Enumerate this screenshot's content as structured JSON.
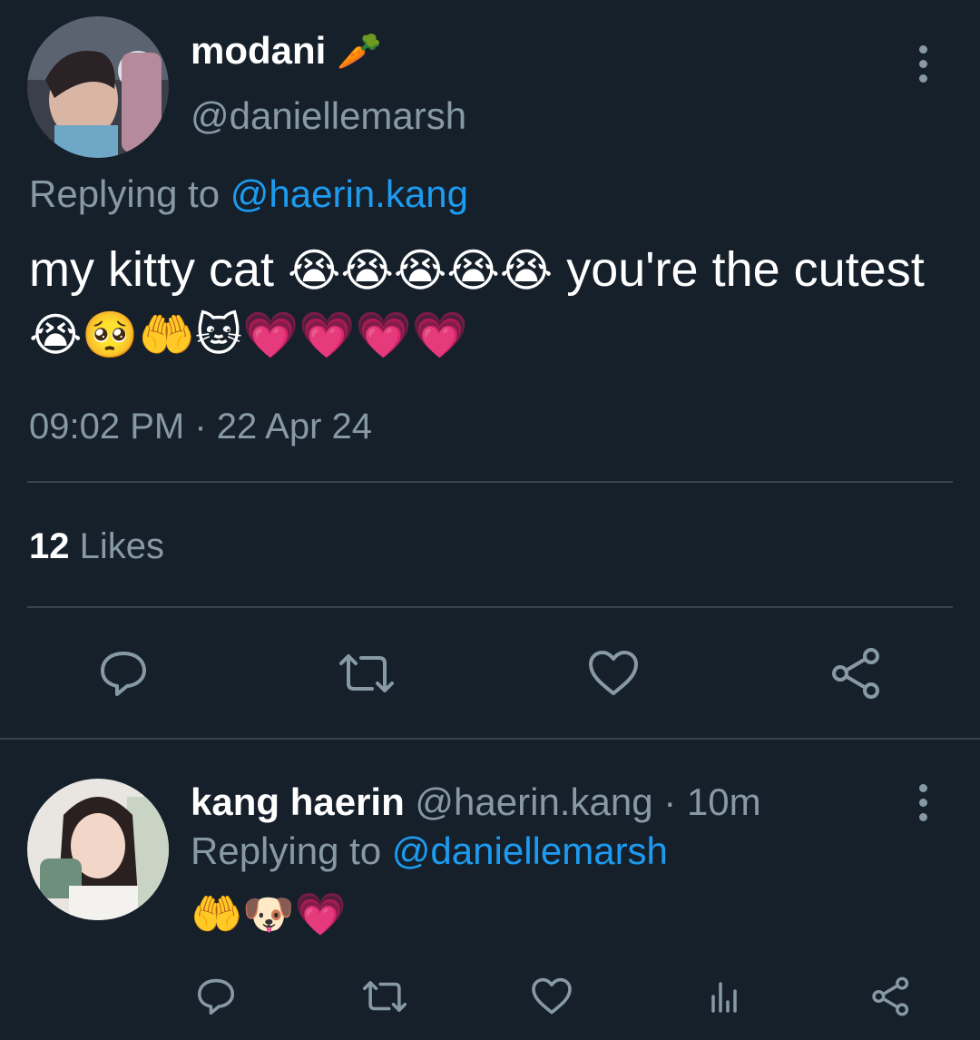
{
  "main_tweet": {
    "display_name": "modani",
    "name_emoji": "🥕",
    "handle": "@daniellemarsh",
    "replying_to_label": "Replying to",
    "replying_to_handle": "@haerin.kang",
    "text_part1": "my kitty cat",
    "emoji_part1": "😭😭😭😭😭",
    "text_part2": "you're the cutest",
    "emoji_part2": "😭🥺🤲🐱💗💗💗💗",
    "timestamp": "09:02 PM · 22 Apr 24",
    "likes_count": "12",
    "likes_label": "Likes"
  },
  "reply_tweet": {
    "display_name": "kang haerin",
    "handle": "@haerin.kang",
    "separator": "·",
    "time_ago": "10m",
    "replying_to_label": "Replying to",
    "replying_to_handle": "@daniellemarsh",
    "text": "🤲🐶💗"
  },
  "icons": {
    "reply": "speech-bubble-icon",
    "retweet": "retweet-icon",
    "like": "heart-icon",
    "share": "share-icon",
    "analytics": "bar-chart-icon",
    "menu": "vertical-dots-icon"
  },
  "colors": {
    "background": "#15202b",
    "muted": "#8899a6",
    "link": "#1d9bf0",
    "divider": "#38444d"
  }
}
